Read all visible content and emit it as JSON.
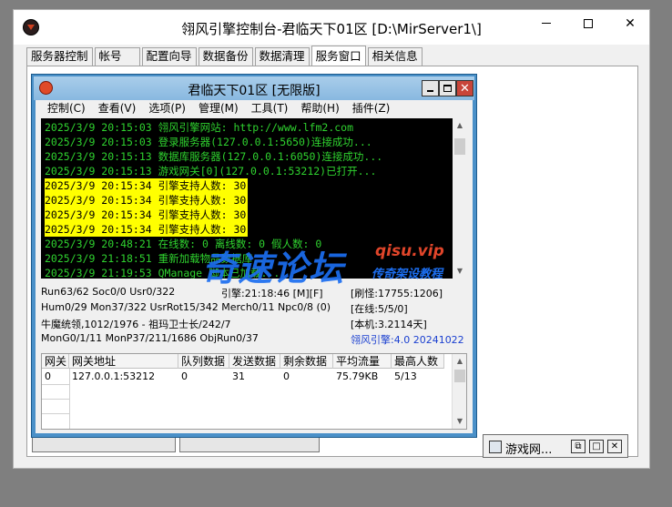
{
  "outer_window": {
    "title": "翎风引擎控制台-君临天下01区 [D:\\MirServer1\\]",
    "tabs": [
      "服务器控制",
      "帐号",
      "配置向导",
      "数据备份",
      "数据清理",
      "服务窗口",
      "相关信息"
    ],
    "active_tab": "服务窗口",
    "minimized_window_label": "游戏网..."
  },
  "inner_window": {
    "title": "君临天下01区 [无限版]",
    "menu": [
      "控制(C)",
      "查看(V)",
      "选项(P)",
      "管理(M)",
      "工具(T)",
      "帮助(H)",
      "插件(Z)"
    ],
    "log_lines": [
      {
        "text": "2025/3/9 20:15:03 翎风引擎网站: http://www.lfm2.com",
        "highlight": false
      },
      {
        "text": "2025/3/9 20:15:03 登录服务器(127.0.0.1:5650)连接成功...",
        "highlight": false
      },
      {
        "text": "2025/3/9 20:15:13 数据库服务器(127.0.0.1:6050)连接成功...",
        "highlight": false
      },
      {
        "text": "2025/3/9 20:15:13 游戏网关[0](127.0.0.1:53212)已打开...",
        "highlight": false
      },
      {
        "text": "2025/3/9 20:15:34 引擎支持人数: 30",
        "highlight": true
      },
      {
        "text": "2025/3/9 20:15:34 引擎支持人数: 30",
        "highlight": true
      },
      {
        "text": "2025/3/9 20:15:34 引擎支持人数: 30",
        "highlight": true
      },
      {
        "text": "2025/3/9 20:15:34 引擎支持人数: 30",
        "highlight": true
      },
      {
        "text": "2025/3/9 20:48:21 在线数: 0 离线数: 0 假人数: 0",
        "highlight": false
      },
      {
        "text": "2025/3/9 21:18:51 重新加载物品数据库...",
        "highlight": false
      },
      {
        "text": "2025/3/9 21:19:53 QManage 脚本已加载...",
        "highlight": false
      }
    ],
    "stats": {
      "r1c1": "Run63/62 Soc0/0 Usr0/322",
      "r1c2": "引擎:21:18:46 [M][F]",
      "r1c3": "[刷怪:17755:1206]",
      "r2c1": "Hum0/29 Mon37/322 UsrRot15/342 Merch0/11 Npc0/8 (0)",
      "r2c3": "[在线:5/5/0]",
      "r3c1": "牛魔统领,1012/1976 - 祖玛卫士长/242/7",
      "r3c3": "[本机:3.2114天]",
      "r4c1": "MonG0/1/11 MonP37/211/1686 ObjRun0/37",
      "r4c3": "翎风引擎:4.0 20241022"
    },
    "table": {
      "headers": [
        "网关",
        "网关地址",
        "队列数据",
        "发送数据",
        "剩余数据",
        "平均流量",
        "最高人数"
      ],
      "rows": [
        [
          "0",
          "127.0.0.1:53212",
          "0",
          "31",
          "0",
          "75.79KB",
          "5/13"
        ]
      ]
    }
  },
  "watermark": {
    "cn": "奇速论坛",
    "en": "qisu.vip",
    "sub": "传奇架设教程"
  },
  "colors": {
    "console_bg": "#000000",
    "console_text": "#2fd22f",
    "highlight_bg": "#ffff00",
    "inner_frame": "#4a90c8",
    "version_text": "#1a3fd0"
  }
}
